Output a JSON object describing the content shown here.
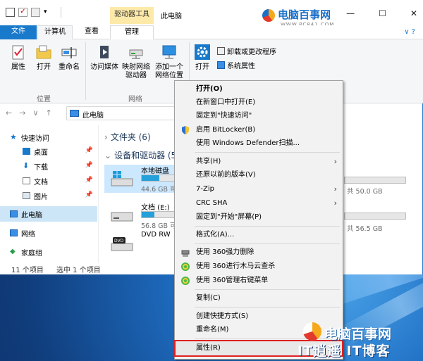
{
  "window": {
    "title": "此电脑",
    "context_tab_header": "驱动器工具",
    "logo_text": "电脑百事网",
    "logo_url": "WWW.PC841.COM",
    "controls": [
      "—",
      "☐",
      "✕"
    ]
  },
  "ribbon": {
    "tabs": [
      "文件",
      "计算机",
      "查看",
      "管理"
    ],
    "help": "∨ ?",
    "location": {
      "label": "位置",
      "buttons": [
        "属性",
        "打开",
        "重命名"
      ]
    },
    "network": {
      "label": "网络",
      "buttons": [
        "访问媒体",
        "映射网络驱动器",
        "添加一个网络位置"
      ]
    },
    "system": {
      "open_settings": "打开",
      "uninstall": "卸载或更改程序",
      "system_properties": "系统属性",
      "manage": "管理"
    }
  },
  "address": {
    "path": "此电脑",
    "nav": [
      "←",
      "→",
      "∨",
      "↑"
    ]
  },
  "navpane": {
    "items": [
      {
        "label": "快速访问",
        "pinned": false
      },
      {
        "label": "桌面",
        "pinned": true
      },
      {
        "label": "下载",
        "pinned": true
      },
      {
        "label": "文档",
        "pinned": true
      },
      {
        "label": "图片",
        "pinned": true
      },
      {
        "label": "此电脑",
        "pinned": false
      },
      {
        "label": "网络",
        "pinned": false
      },
      {
        "label": "家庭组",
        "pinned": false
      }
    ]
  },
  "content": {
    "folders_header": "文件夹 (6)",
    "devices_header": "设备和驱动器 (5",
    "drives": [
      {
        "name": "本地磁盘",
        "size": "44.6 GB 可",
        "fill": 0.55
      },
      {
        "name": "文档 (E:)",
        "size": "56.8 GB 可",
        "fill": 0.4
      },
      {
        "name": "DVD RW",
        "size": "",
        "fill": 0
      }
    ],
    "right_sizes": [
      "共 50.0 GB",
      "共 56.5 GB"
    ]
  },
  "status": {
    "count": "11 个项目",
    "selected": "选中 1 个项目"
  },
  "context_menu": {
    "items": [
      {
        "label": "打开(O)",
        "bold": true,
        "icon": "",
        "sub": false
      },
      {
        "label": "在新窗口中打开(E)",
        "bold": false,
        "icon": "",
        "sub": false
      },
      {
        "label": "固定到\"快速访问\"",
        "bold": false,
        "icon": "",
        "sub": false
      },
      {
        "label": "启用 BitLocker(B)",
        "bold": false,
        "icon": "shield-icon",
        "sub": false
      },
      {
        "label": "使用 Windows Defender扫描...",
        "bold": false,
        "icon": "",
        "sub": false
      },
      {
        "label": "共享(H)",
        "bold": false,
        "icon": "",
        "sub": true
      },
      {
        "label": "还原以前的版本(V)",
        "bold": false,
        "icon": "",
        "sub": false
      },
      {
        "label": "7-Zip",
        "bold": false,
        "icon": "",
        "sub": true
      },
      {
        "label": "CRC SHA",
        "bold": false,
        "icon": "",
        "sub": true
      },
      {
        "label": "固定到\"开始\"屏幕(P)",
        "bold": false,
        "icon": "",
        "sub": false
      },
      {
        "label": "格式化(A)...",
        "bold": false,
        "icon": "",
        "sub": false
      },
      {
        "label": "使用 360强力删除",
        "bold": false,
        "icon": "shredder-icon",
        "sub": false
      },
      {
        "label": "使用 360进行木马云查杀",
        "bold": false,
        "icon": "360-icon",
        "sub": false
      },
      {
        "label": "使用 360管理右键菜单",
        "bold": false,
        "icon": "360-icon",
        "sub": false
      },
      {
        "label": "复制(C)",
        "bold": false,
        "icon": "",
        "sub": false
      },
      {
        "label": "创建快捷方式(S)",
        "bold": false,
        "icon": "",
        "sub": false
      },
      {
        "label": "重命名(M)",
        "bold": false,
        "icon": "",
        "sub": false
      },
      {
        "label": "属性(R)",
        "bold": false,
        "icon": "",
        "sub": false,
        "highlighted": true
      }
    ],
    "highlight_color": "#e02020"
  },
  "watermark": {
    "line1": "电脑百事网",
    "line2": "IT逍遥 IT博客"
  }
}
